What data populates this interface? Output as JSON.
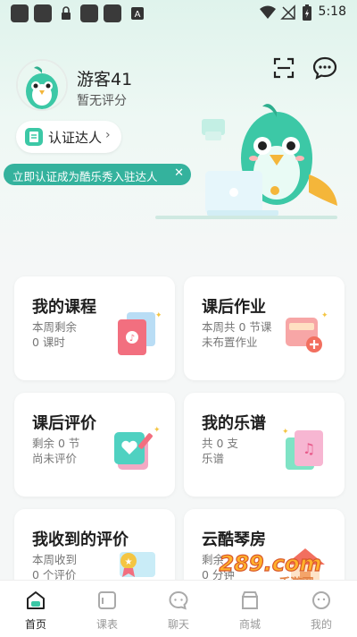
{
  "status_bar": {
    "time": "5:18",
    "icons": [
      "app-icon",
      "lock-icon",
      "app-icon",
      "app-icon",
      "a-icon",
      "wifi-icon",
      "no-signal-icon",
      "battery-charging-icon"
    ]
  },
  "profile": {
    "name": "游客41",
    "rating": "暂无评分"
  },
  "header_icons": {
    "scan": "scan-icon",
    "chat": "chat-bubble-icon"
  },
  "certify": {
    "label": "认证达人",
    "arrow": "›"
  },
  "tip": {
    "text": "立即认证成为酷乐秀入驻达人",
    "close": "✕"
  },
  "cards": [
    {
      "title": "我的课程",
      "line1": "本周剩余",
      "line2": "0 课时",
      "icon": "music-book-icon"
    },
    {
      "title": "课后作业",
      "line1": "本周共 0 节课",
      "line2": "未布置作业",
      "icon": "homework-add-icon"
    },
    {
      "title": "课后评价",
      "line1": "剩余 0 节",
      "line2": "尚未评价",
      "icon": "heart-edit-icon"
    },
    {
      "title": "我的乐谱",
      "line1": "共 0 支",
      "line2": "乐谱",
      "icon": "sheet-music-icon"
    },
    {
      "title": "我收到的评价",
      "line1": "本周收到",
      "line2": "0 个评价",
      "icon": "award-scroll-icon"
    },
    {
      "title": "云酷琴房",
      "line1": "剩余",
      "line2": "0 分钟",
      "icon": "piano-house-icon"
    }
  ],
  "tabs": [
    {
      "label": "首页",
      "icon": "home-icon",
      "active": true
    },
    {
      "label": "课表",
      "icon": "schedule-icon",
      "active": false
    },
    {
      "label": "聊天",
      "icon": "chat-icon",
      "active": false
    },
    {
      "label": "商城",
      "icon": "shop-icon",
      "active": false
    },
    {
      "label": "我的",
      "icon": "profile-icon",
      "active": false
    }
  ],
  "watermark": {
    "text": "289.com",
    "sub": "手游网"
  },
  "colors": {
    "accent": "#34b29d",
    "accent_light": "#3cc8a6",
    "background": "#f5f7f7"
  }
}
